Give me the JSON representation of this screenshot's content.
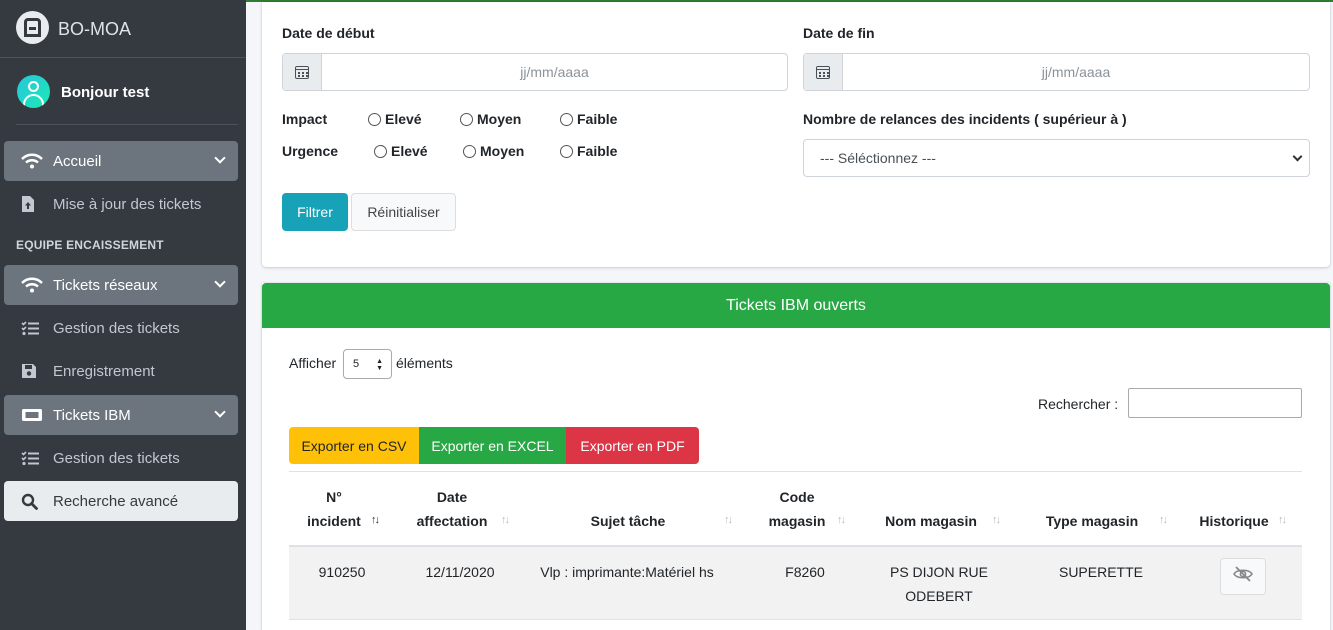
{
  "brand": {
    "name": "BO-MOA"
  },
  "user": {
    "greeting": "Bonjour test"
  },
  "sidebar": {
    "items": [
      {
        "label": "Accueil",
        "icon": "wifi-icon",
        "type": "head"
      },
      {
        "label": "Mise à jour des tickets",
        "icon": "file-upload-icon",
        "type": "link"
      },
      {
        "label": "EQUIPE ENCAISSEMENT",
        "type": "header"
      },
      {
        "label": "Tickets réseaux",
        "icon": "wifi-icon",
        "type": "head"
      },
      {
        "label": "Gestion des tickets",
        "icon": "list-check-icon",
        "type": "link"
      },
      {
        "label": "Enregistrement",
        "icon": "save-icon",
        "type": "link"
      },
      {
        "label": "Tickets IBM",
        "icon": "ticket-icon",
        "type": "head"
      },
      {
        "label": "Gestion des tickets",
        "icon": "list-check-icon",
        "type": "link"
      },
      {
        "label": "Recherche avancé",
        "icon": "search-icon",
        "type": "active"
      }
    ]
  },
  "filters": {
    "start_label": "Date de début",
    "end_label": "Date de fin",
    "date_placeholder": "jj/mm/aaaa",
    "impact_label": "Impact",
    "urgence_label": "Urgence",
    "levels": [
      "Elevé",
      "Moyen",
      "Faible"
    ],
    "relances_label": "Nombre de relances des incidents ( supérieur à )",
    "relances_value": "--- Séléctionnez ---",
    "filter_button": "Filtrer",
    "reset_button": "Réinitialiser"
  },
  "tickets": {
    "title": "Tickets IBM ouverts",
    "show_prefix": "Afficher",
    "show_value": "5",
    "show_suffix": "éléments",
    "search_label": "Rechercher :",
    "export_csv": "Exporter en CSV",
    "export_excel": "Exporter en EXCEL",
    "export_pdf": "Exporter en PDF",
    "columns": [
      {
        "line1": "N°",
        "line2": "incident"
      },
      {
        "line1": "Date",
        "line2": "affectation"
      },
      {
        "line1": "",
        "line2": "Sujet tâche"
      },
      {
        "line1": "Code",
        "line2": "magasin"
      },
      {
        "line1": "",
        "line2": "Nom magasin"
      },
      {
        "line1": "",
        "line2": "Type magasin"
      },
      {
        "line1": "",
        "line2": "Historique"
      }
    ],
    "rows": [
      {
        "incident": "910250",
        "date": "12/11/2020",
        "sujet": "Vlp : imprimante:Matériel hs",
        "code": "F8260",
        "nom_line1": "PS DIJON RUE",
        "nom_line2": "ODEBERT",
        "type": "SUPERETTE",
        "historique_icon": "eye-slash-icon"
      }
    ]
  }
}
